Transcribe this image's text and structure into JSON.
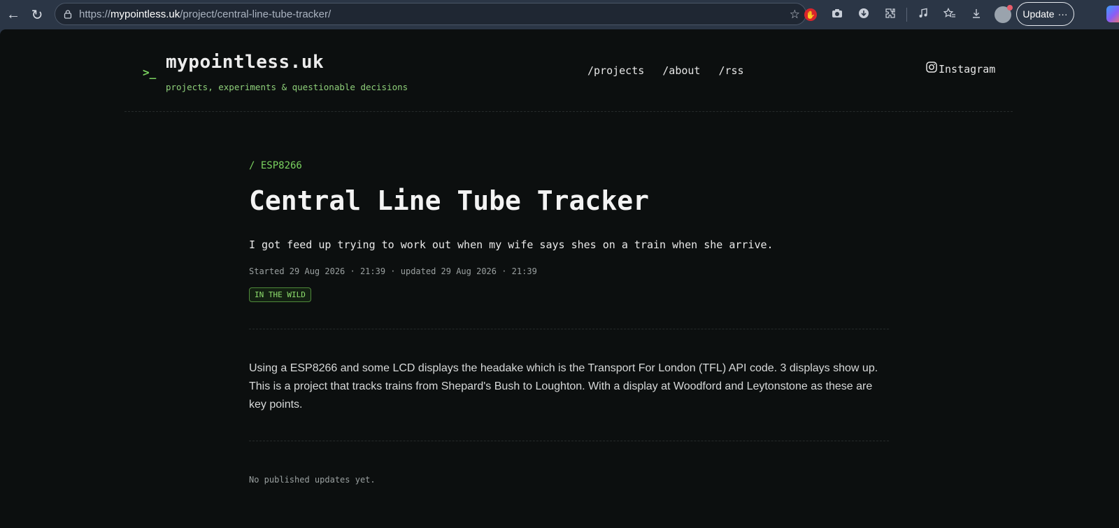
{
  "browser": {
    "url_host": "mypointless.uk",
    "url_prefix": "https://",
    "url_path": "/project/central-line-tube-tracker/",
    "update_label": "Update",
    "update_more": "···"
  },
  "site": {
    "prompt": ">_",
    "title": "mypointless.uk",
    "tagline": "projects, experiments & questionable decisions",
    "nav": [
      "/projects",
      "/about",
      "/rss"
    ],
    "instagram_label": "Instagram"
  },
  "article": {
    "crumb": "/ ESP8266",
    "title": "Central Line Tube Tracker",
    "lede": "I got feed up trying to work out when my wife says shes on a train when she arrive.",
    "meta": "Started 29 Aug 2026 · 21:39 · updated 29 Aug 2026 · 21:39",
    "badge": "IN THE WILD",
    "body": "Using a ESP8266 and some LCD displays the headake which is the Transport For London (TFL) API code. 3 displays show up. This is a project that tracks trains from Shepard's Bush to Loughton. With a display at Woodford and Leytonstone as these are key points.",
    "no_updates": "No published updates yet."
  },
  "icons": {
    "back": "back-arrow-icon",
    "reload": "reload-icon",
    "lock": "lock-icon",
    "star": "favorite-star-icon"
  },
  "colors": {
    "accent": "#7ad25f",
    "page_bg": "#0c0f0f",
    "chrome_bg": "#2b3646"
  }
}
